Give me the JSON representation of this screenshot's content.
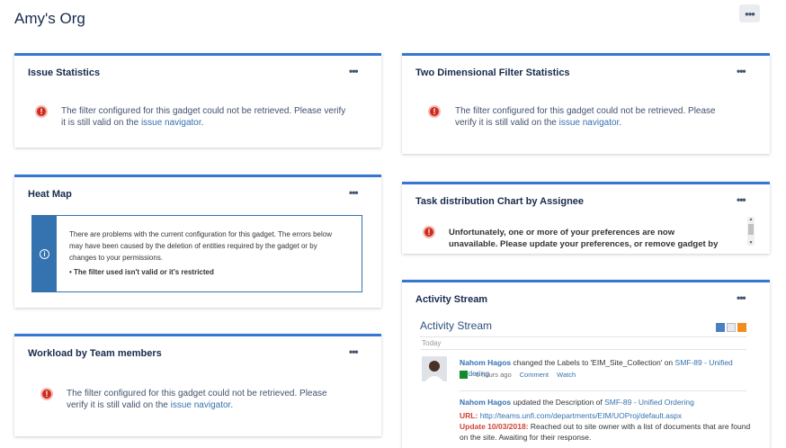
{
  "page": {
    "title": "Amy's Org",
    "more_label": "•••"
  },
  "error": {
    "text": "The filter configured for this gadget could not be retrieved. Please verify it is still valid on the",
    "link": "issue navigator",
    "tail": ".",
    "icon": "error-icon"
  },
  "gadgets": {
    "issue_statistics": {
      "title": "Issue Statistics"
    },
    "two_dimensional": {
      "title": "Two Dimensional Filter Statistics"
    },
    "heat_map": {
      "title": "Heat Map",
      "message": "There are problems with the current configuration for this gadget. The errors below may have been caused by the deletion of entities required by the gadget or by changes to your permissions.",
      "bullet": "The filter used isn't valid or it's restricted"
    },
    "task_distribution": {
      "title": "Task distribution Chart by Assignee",
      "message": "Unfortunately, one or more of your preferences are now unavailable. Please update your preferences, or remove gadget by clicking delete."
    },
    "workload": {
      "title": "Workload by Team members"
    },
    "activity_stream": {
      "title": "Activity Stream",
      "heading": "Activity Stream",
      "today": "Today",
      "entries": [
        {
          "user": "Nahom Hagos",
          "action": "changed the Labels to 'EIM_Site_Collection' on",
          "issue": "SMF-89 - Unified Ordering",
          "time": "6 hours ago",
          "comment": "Comment",
          "watch": "Watch"
        },
        {
          "user": "Nahom Hagos",
          "action": "updated the Description of",
          "issue": "SMF-89 - Unified Ordering",
          "url_label": "URL:",
          "url": "http://teams.unfi.com/departments/EIM/UOProj/default.aspx",
          "update_label": "Update 10/03/2018:",
          "update_text": "Reached out to site owner with a list of documents that are found on the site. Awaiting for their response."
        }
      ]
    }
  },
  "colors": {
    "accent": "#3577d4",
    "error": "#ce2b1e",
    "link": "#3572b0",
    "info": "#3572b0"
  }
}
